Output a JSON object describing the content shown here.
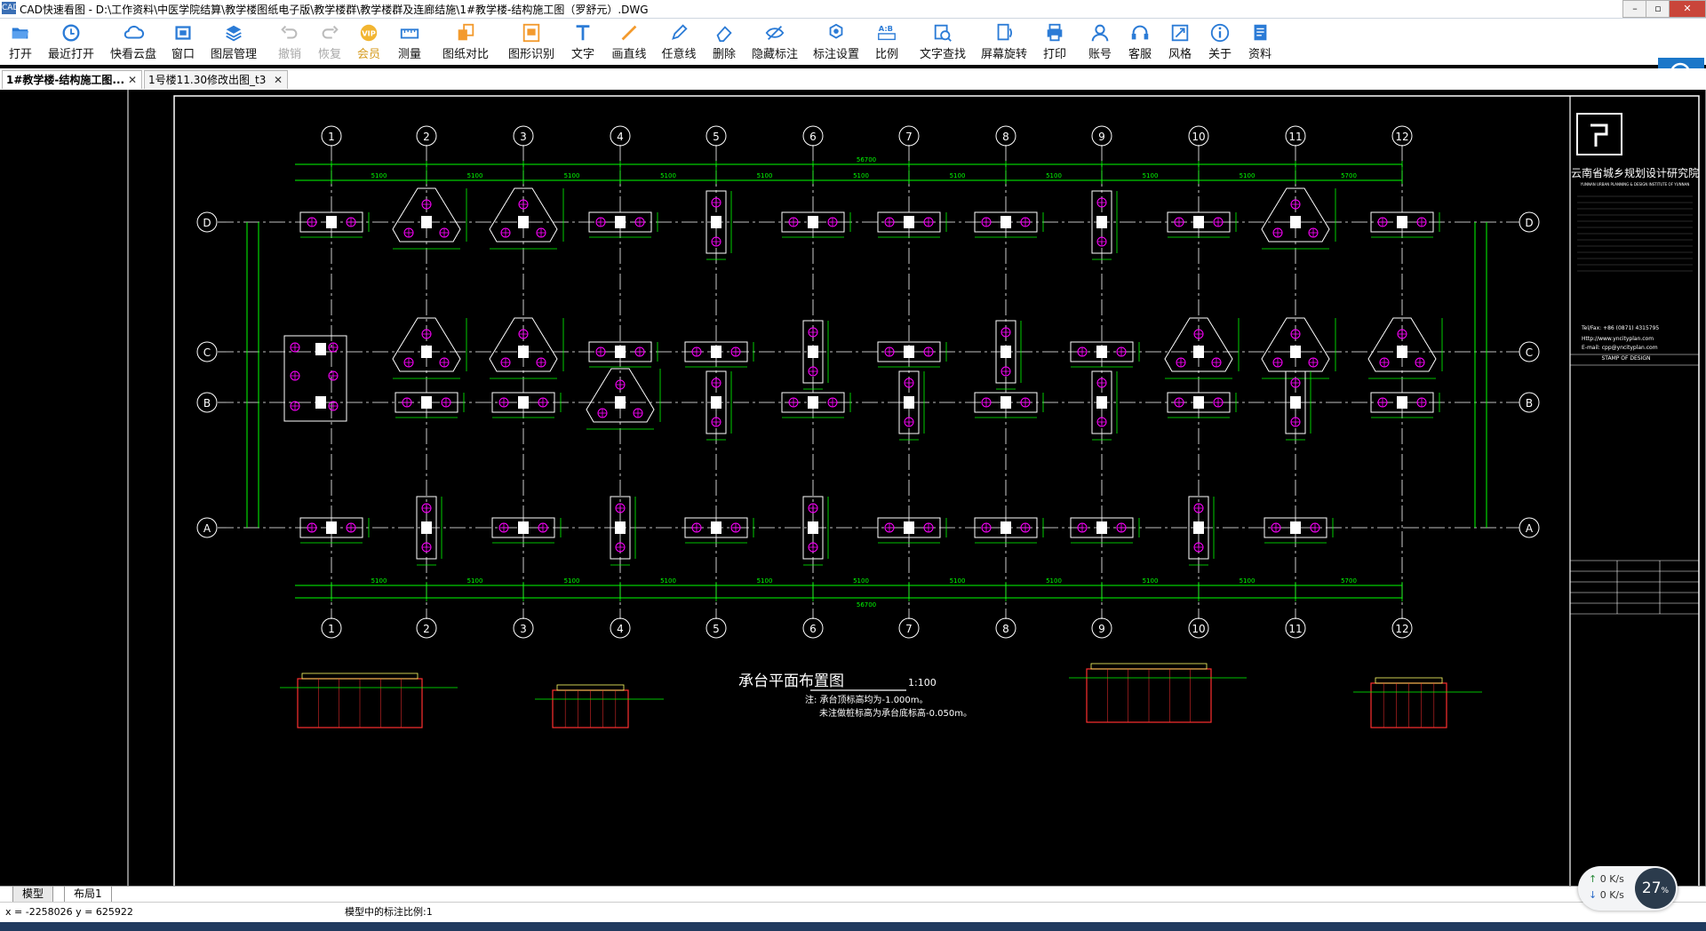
{
  "window": {
    "app_icon_text": "CAD",
    "title": "CAD快速看图 - D:\\工作资料\\中医学院结算\\教学楼图纸电子版\\教学楼群\\教学楼群及连廊结施\\1#教学楼-结构施工图（罗舒元）.DWG",
    "controls": [
      "–",
      "▫",
      "✕"
    ]
  },
  "toolbar": {
    "items": [
      {
        "label": "打开",
        "icon": "folder-open-icon",
        "state": "normal"
      },
      {
        "label": "最近打开",
        "icon": "recent-clock-icon",
        "state": "normal"
      },
      {
        "label": "快看云盘",
        "icon": "cloud-icon",
        "state": "normal"
      },
      {
        "label": "窗口",
        "icon": "window-icon",
        "state": "normal"
      },
      {
        "label": "图层管理",
        "icon": "layers-icon",
        "state": "normal"
      },
      {
        "label": "撤销",
        "icon": "undo-icon",
        "state": "disabled"
      },
      {
        "label": "恢复",
        "icon": "redo-icon",
        "state": "disabled"
      },
      {
        "label": "会员",
        "icon": "vip-icon",
        "state": "vip"
      },
      {
        "label": "测量",
        "icon": "ruler-icon",
        "state": "normal"
      },
      {
        "label": "图纸对比",
        "icon": "compare-icon",
        "state": "normal"
      },
      {
        "label": "图形识别",
        "icon": "shape-recognition-icon",
        "state": "normal"
      },
      {
        "label": "文字",
        "icon": "text-icon",
        "state": "normal"
      },
      {
        "label": "画直线",
        "icon": "line-icon",
        "state": "normal"
      },
      {
        "label": "任意线",
        "icon": "pen-icon",
        "state": "normal"
      },
      {
        "label": "删除",
        "icon": "eraser-icon",
        "state": "normal"
      },
      {
        "label": "隐藏标注",
        "icon": "hide-eye-icon",
        "state": "normal"
      },
      {
        "label": "标注设置",
        "icon": "annotation-settings-icon",
        "state": "normal"
      },
      {
        "label": "比例",
        "icon": "scale-icon",
        "state": "normal"
      },
      {
        "label": "文字查找",
        "icon": "text-search-icon",
        "state": "normal"
      },
      {
        "label": "屏幕旋转",
        "icon": "rotate-screen-icon",
        "state": "normal"
      },
      {
        "label": "打印",
        "icon": "printer-icon",
        "state": "normal"
      },
      {
        "label": "账号",
        "icon": "user-icon",
        "state": "normal"
      },
      {
        "label": "客服",
        "icon": "headset-icon",
        "state": "normal"
      },
      {
        "label": "风格",
        "icon": "style-icon",
        "state": "normal"
      },
      {
        "label": "关于",
        "icon": "info-icon",
        "state": "normal"
      },
      {
        "label": "资料",
        "icon": "documents-icon",
        "state": "normal"
      }
    ]
  },
  "tabs": [
    {
      "label": "1#教学楼-结构施工图...",
      "active": true
    },
    {
      "label": "1号楼11.30修改出图_t3",
      "active": false
    }
  ],
  "drawing": {
    "grid_columns": [
      "1",
      "2",
      "3",
      "4",
      "5",
      "6",
      "7",
      "8",
      "9",
      "10",
      "11",
      "12"
    ],
    "grid_rows": [
      "D",
      "C",
      "B",
      "A"
    ],
    "overall_dimension": "56700",
    "bay_dimensions": [
      "5100",
      "5100",
      "5100",
      "5100",
      "5100",
      "5100",
      "5100",
      "5100",
      "5100",
      "5100",
      "5700"
    ],
    "plan_title": "承台平面布置图",
    "plan_scale": "1:100",
    "notes": [
      "注: 承台顶标高均为-1.000m。",
      "未注做桩标高为承台底标高-0.050m。"
    ],
    "title_block": {
      "institute_cn": "云南省城乡规划设计研究院",
      "institute_en": "YUNNAN URBAN PLANNING & DESIGN INSTITUTE OF YUNNAN",
      "stamp_label": "STAMP OF DESIGN",
      "website": "Http://www.yncityplan.com",
      "email": "E-mail: cpp@yncityplan.com",
      "phone": "Tel/Fax: +86 (0871) 4315795"
    },
    "colors": {
      "grid": "#ffffff",
      "dimension": "#00ff00",
      "pile_cap": "#ffffff",
      "pile": "#ff00ff",
      "frame": "#ffffff",
      "section": "#ff3030"
    }
  },
  "layout_tabs": [
    {
      "label": "模型",
      "active": true
    },
    {
      "label": "布局1",
      "active": false
    }
  ],
  "status": {
    "coords": "x = -2258026  y = 625922",
    "scale_text": "模型中的标注比例:1"
  },
  "net_widget": {
    "up": "0 K/s",
    "down": "0 K/s",
    "percent": "27"
  }
}
